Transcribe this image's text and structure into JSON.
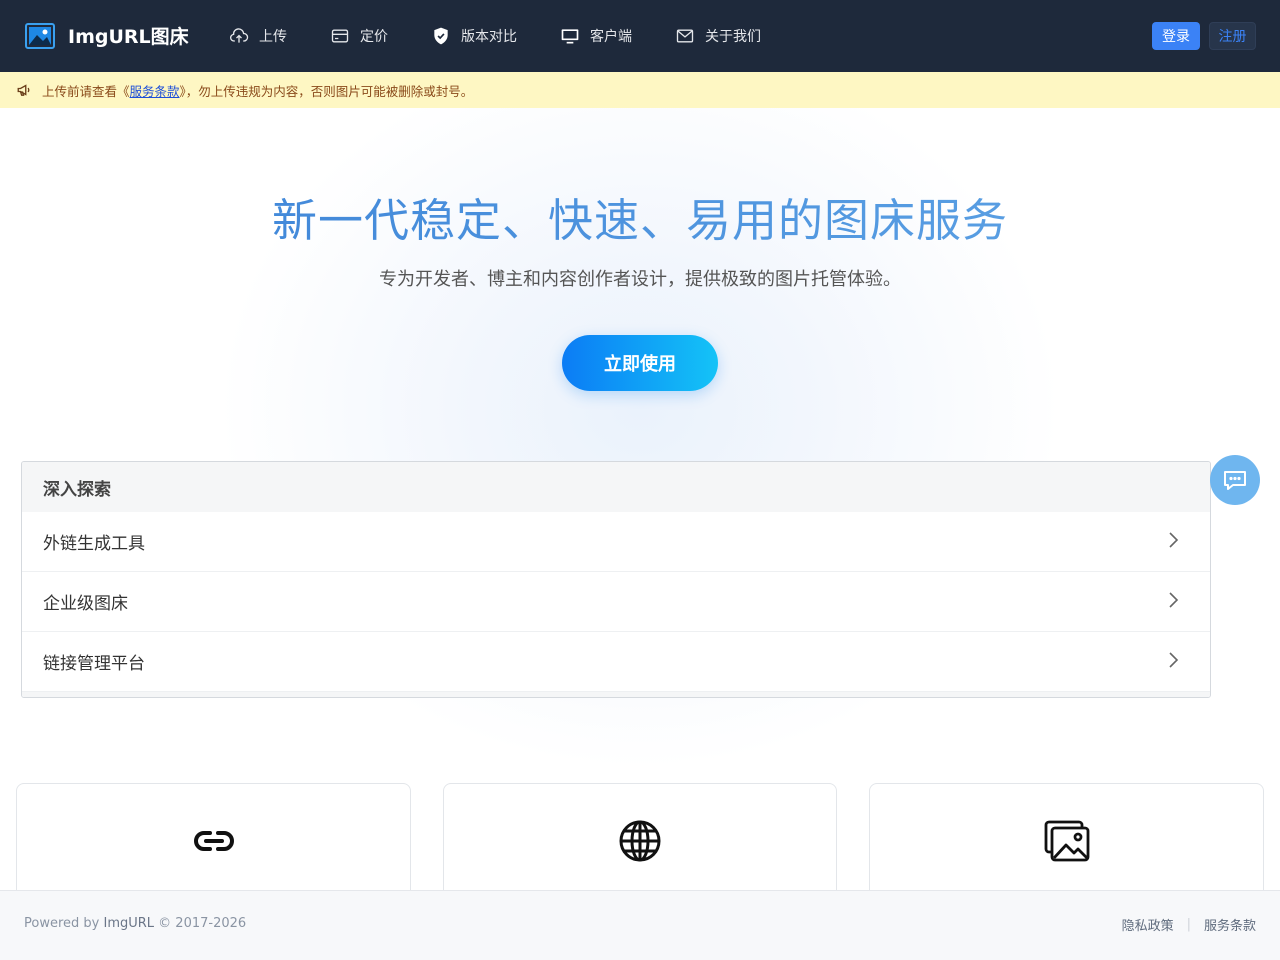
{
  "header": {
    "brand_name": "ImgURL图床",
    "nav": [
      {
        "label": "上传",
        "icon": "cloud-upload-icon"
      },
      {
        "label": "定价",
        "icon": "credit-card-icon"
      },
      {
        "label": "版本对比",
        "icon": "shield-check-icon"
      },
      {
        "label": "客户端",
        "icon": "desktop-icon"
      },
      {
        "label": "关于我们",
        "icon": "mail-icon"
      }
    ],
    "login_label": "登录",
    "register_label": "注册"
  },
  "notice": {
    "prefix": "上传前请查看《",
    "link": "服务条款",
    "suffix": "》，勿上传违规为内容，否则图片可能被删除或封号。",
    "icon": "megaphone-icon"
  },
  "hero": {
    "title": "新一代稳定、快速、易用的图床服务",
    "subtitle": "专为开发者、博主和内容创作者设计，提供极致的图片托管体验。",
    "cta_label": "立即使用"
  },
  "explore": {
    "title": "深入探索",
    "items": [
      {
        "label": "外链生成工具"
      },
      {
        "label": "企业级图床"
      },
      {
        "label": "链接管理平台"
      }
    ]
  },
  "cards": [
    {
      "icon": "link-icon"
    },
    {
      "icon": "globe-icon"
    },
    {
      "icon": "images-icon"
    }
  ],
  "footer": {
    "powered_prefix": "Powered by ",
    "powered_brand": "ImgURL",
    "copyright": " © 2017-2026",
    "privacy": "隐私政策",
    "separator": "|",
    "terms": "服务条款"
  },
  "colors": {
    "header_bg": "#1e293b",
    "accent": "#3b82f6",
    "notice_bg": "#fef7c3",
    "cta_start": "#0b7cf5",
    "cta_end": "#14c3f7"
  }
}
